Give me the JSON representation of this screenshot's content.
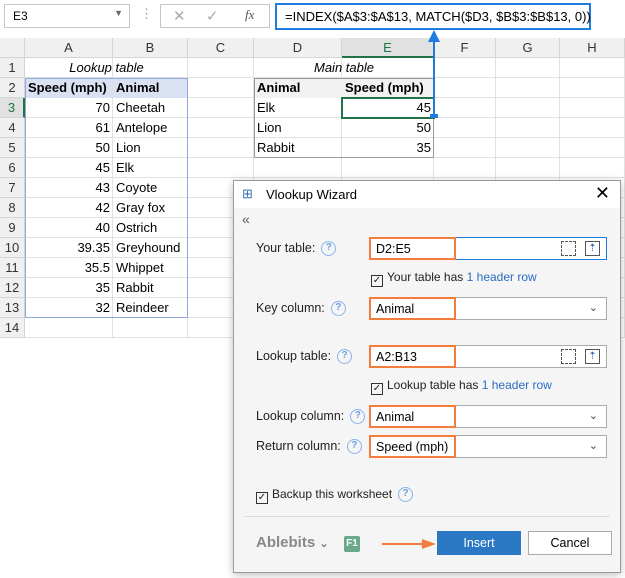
{
  "formula_bar": {
    "name_box": "E3",
    "cancel_icon": "✕",
    "enter_icon": "✓",
    "fx": "fx",
    "formula": "=INDEX($A$3:$A$13, MATCH($D3, $B$3:$B$13, 0))"
  },
  "columns": [
    "A",
    "B",
    "C",
    "D",
    "E",
    "F",
    "G",
    "H"
  ],
  "rows": [
    "1",
    "2",
    "3",
    "4",
    "5",
    "6",
    "7",
    "8",
    "9",
    "10",
    "11",
    "12",
    "13",
    "14"
  ],
  "lookup_table": {
    "title": "Lookup table",
    "headers": [
      "Speed (mph)",
      "Animal"
    ],
    "data": [
      [
        "70",
        "Cheetah"
      ],
      [
        "61",
        "Antelope"
      ],
      [
        "50",
        "Lion"
      ],
      [
        "45",
        "Elk"
      ],
      [
        "43",
        "Coyote"
      ],
      [
        "42",
        "Gray fox"
      ],
      [
        "40",
        "Ostrich"
      ],
      [
        "39.35",
        "Greyhound"
      ],
      [
        "35.5",
        "Whippet"
      ],
      [
        "35",
        "Rabbit"
      ],
      [
        "32",
        "Reindeer"
      ]
    ]
  },
  "main_table": {
    "title": "Main table",
    "headers": [
      "Animal",
      "Speed (mph)"
    ],
    "data": [
      [
        "Elk",
        "45"
      ],
      [
        "Lion",
        "50"
      ],
      [
        "Rabbit",
        "35"
      ]
    ]
  },
  "dialog": {
    "title": "Vlookup Wizard",
    "collapse": "«",
    "your_table_label": "Your table:",
    "your_table": "D2:E5",
    "your_table_header_pre": "Your table has",
    "your_table_header_link": "1 header row",
    "key_column_label": "Key column:",
    "key_column": "Animal",
    "lookup_table_label": "Lookup table:",
    "lookup_table": "A2:B13",
    "lookup_header_pre": "Lookup table has",
    "lookup_header_link": "1 header row",
    "lookup_column_label": "Lookup column:",
    "lookup_column": "Animal",
    "return_column_label": "Return column:",
    "return_column": "Speed (mph)",
    "backup_label": "Backup this worksheet",
    "brand": "Ablebits",
    "f1": "F1",
    "insert": "Insert",
    "cancel": "Cancel",
    "help": "?",
    "check": "✓",
    "chevron": "⌄"
  },
  "colors": {
    "accent": "#1e7be0",
    "highlight": "#f47c3c",
    "insert": "#2b78c5",
    "selection": "#217346"
  }
}
